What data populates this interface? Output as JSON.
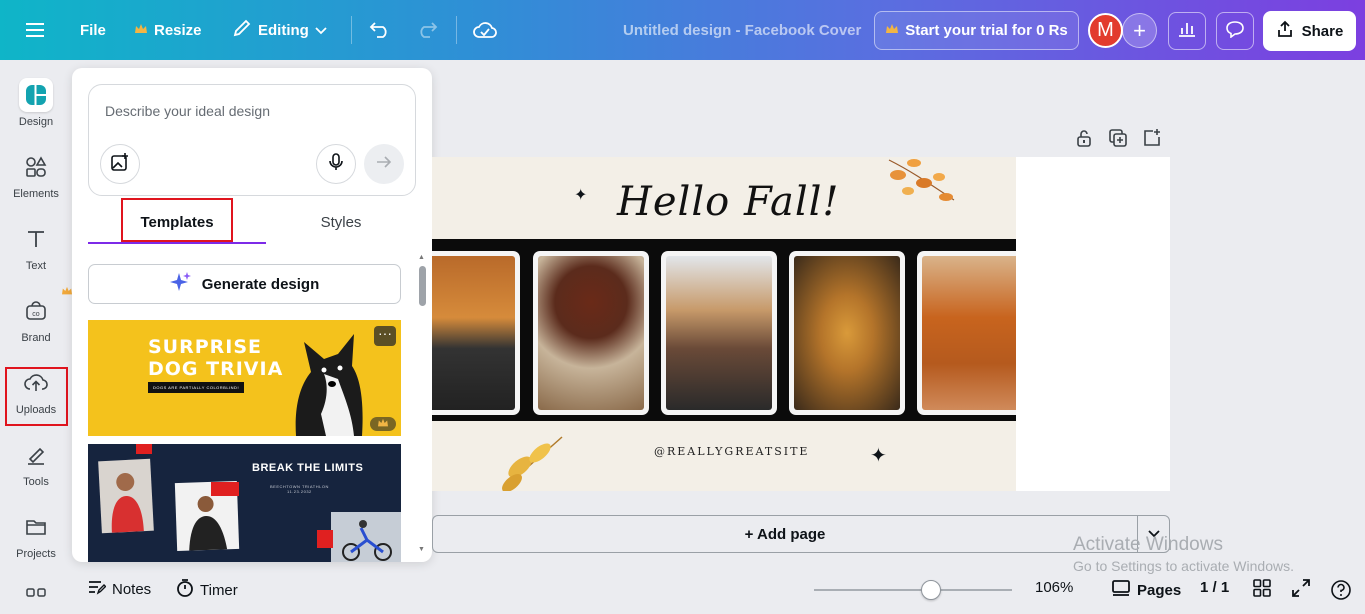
{
  "topbar": {
    "file_label": "File",
    "resize_label": "Resize",
    "editing_label": "Editing",
    "doc_title": "Untitled design - Facebook Cover",
    "trial_label": "Start your trial for 0 Rs",
    "avatar_initial": "M",
    "share_label": "Share"
  },
  "rail": {
    "items": [
      {
        "label": "Design",
        "icon": "design-icon"
      },
      {
        "label": "Elements",
        "icon": "elements-icon"
      },
      {
        "label": "Text",
        "icon": "text-icon"
      },
      {
        "label": "Brand",
        "icon": "brand-icon"
      },
      {
        "label": "Uploads",
        "icon": "uploads-icon"
      },
      {
        "label": "Tools",
        "icon": "tools-icon"
      },
      {
        "label": "Projects",
        "icon": "projects-icon"
      }
    ]
  },
  "panel": {
    "prompt_placeholder": "Describe your ideal design",
    "tabs": [
      {
        "label": "Templates",
        "active": true
      },
      {
        "label": "Styles",
        "active": false
      }
    ],
    "generate_label": "Generate design",
    "templates": [
      {
        "title_line1": "SURPRISE",
        "title_line2": "DOG TRIVIA",
        "subtitle": "DOGS ARE PARTIALLY COLORBLIND!"
      },
      {
        "title": "BREAK THE LIMITS",
        "subtitle_line1": "BEECHTOWN TRIATHLON",
        "subtitle_line2": "11.23.2032"
      }
    ]
  },
  "design": {
    "heading": "Hello Fall!",
    "handle": "@REALLYGREATSITE"
  },
  "canvas": {
    "add_page_label": "+ Add page"
  },
  "bottombar": {
    "notes_label": "Notes",
    "timer_label": "Timer",
    "zoom_value": "106%",
    "zoom_fraction": 0.59,
    "pages_label": "Pages",
    "page_counter": "1 / 1"
  },
  "watermark": {
    "line1": "Activate Windows",
    "line2": "Go to Settings to activate Windows."
  },
  "colors": {
    "accent": "#7d2ae8",
    "highlight": "#e0141e",
    "crown": "#f2a93b"
  }
}
